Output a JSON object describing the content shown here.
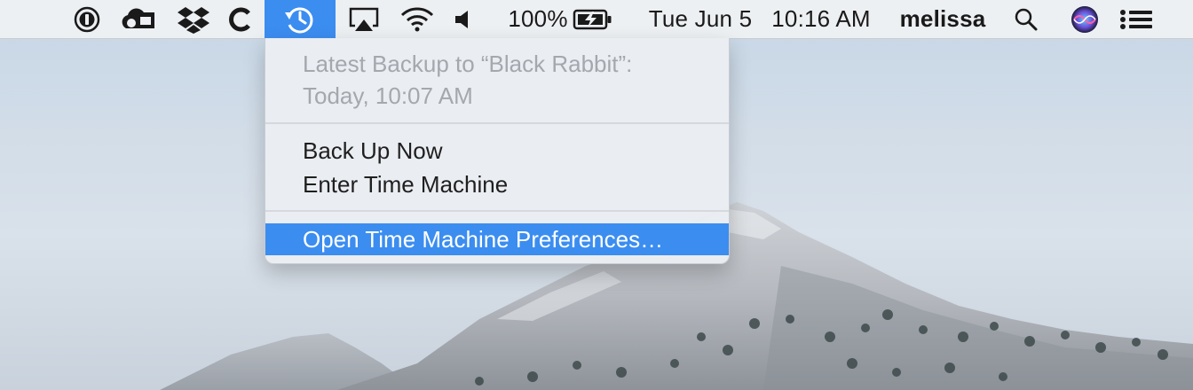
{
  "menubar": {
    "battery_percent": "100%",
    "date": "Tue Jun 5",
    "time": "10:16 AM",
    "user": "melissa",
    "icons": [
      "1password-icon",
      "creative-cloud-icon",
      "dropbox-icon",
      "ccleaner-icon",
      "time-machine-icon",
      "airplay-icon",
      "wifi-icon",
      "volume-icon",
      "battery-charging-icon",
      "spotlight-search-icon",
      "siri-icon",
      "notification-center-icon"
    ]
  },
  "time_machine_menu": {
    "info_line1": "Latest Backup to “Black Rabbit”:",
    "info_line2": "Today, 10:07 AM",
    "back_up_now": "Back Up Now",
    "enter_time_machine": "Enter Time Machine",
    "open_preferences": "Open Time Machine Preferences…"
  },
  "colors": {
    "highlight": "#3b8df0",
    "menubar_bg": "#eef0f3"
  }
}
